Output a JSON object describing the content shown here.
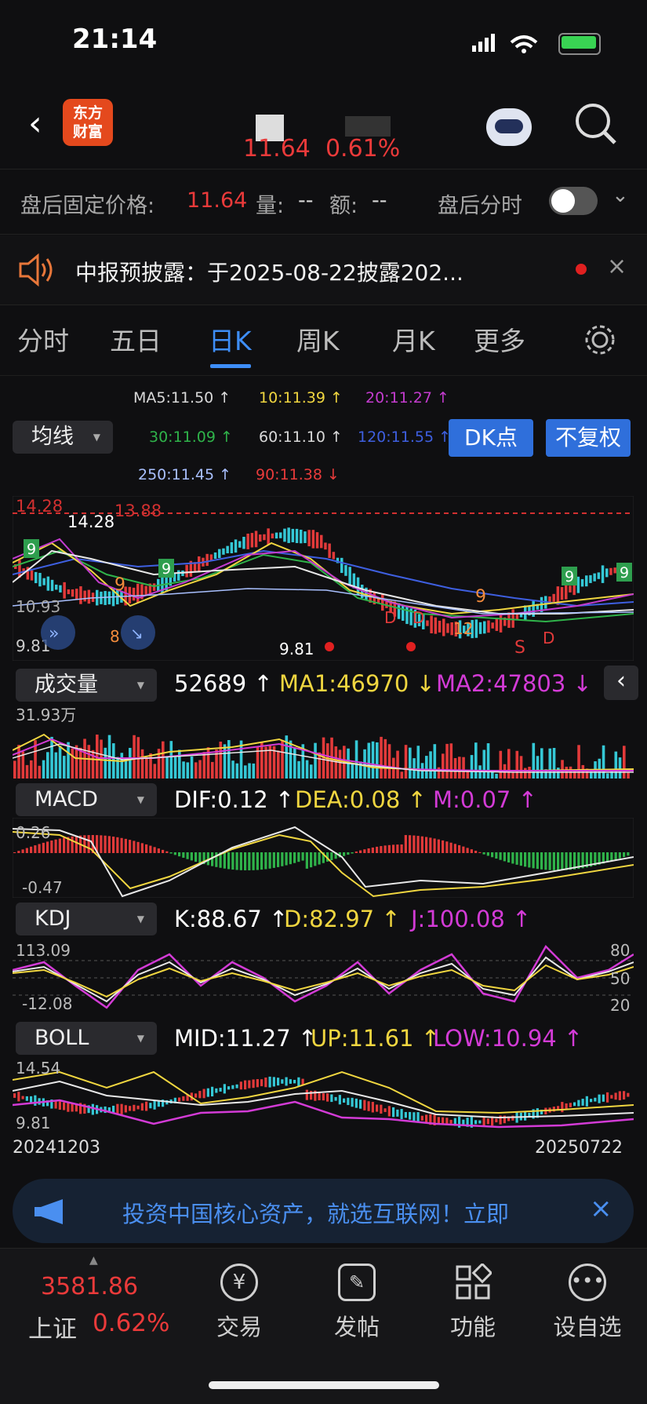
{
  "status": {
    "time": "21:14"
  },
  "header": {
    "logo_text_1": "东方",
    "logo_text_2": "财富",
    "price": "11.64",
    "change_pct": "0.61%"
  },
  "postbar": {
    "label": "盘后固定价格:",
    "price": "11.64",
    "vol_label": "量:",
    "vol_value": "--",
    "amt_label": "额:",
    "amt_value": "--",
    "fenshi_label": "盘后分时"
  },
  "notice": {
    "text": "中报预披露：于2025-08-22披露202..."
  },
  "tabs": [
    "分时",
    "五日",
    "日K",
    "周K",
    "月K",
    "更多"
  ],
  "ma_panel": {
    "dropdown": "均线",
    "ma": [
      {
        "text": "MA5:11.50 ↑",
        "color": "#e8e8e8"
      },
      {
        "text": "10:11.39 ↑",
        "color": "#f0d640"
      },
      {
        "text": "20:11.27 ↑",
        "color": "#c43ccf"
      },
      {
        "text": "30:11.09 ↑",
        "color": "#2fb34a"
      },
      {
        "text": "60:11.10 ↑",
        "color": "#dddddd"
      },
      {
        "text": "120:11.55 ↑",
        "color": "#3e5fe0"
      },
      {
        "text": "250:11.45 ↑",
        "color": "#a9c0ff"
      },
      {
        "text": "90:11.38 ↓",
        "color": "#e83b3b"
      }
    ],
    "dk_button": "DK点",
    "fq_button": "不复权"
  },
  "kline": {
    "price_label_top": "14.28",
    "dash_label": "13.88",
    "mid_label": "10.93",
    "low_left": "9.81",
    "low_mark": "9.81",
    "label_8": "8",
    "label_12": "12"
  },
  "volume": {
    "dropdown": "成交量",
    "value": "52689 ↑",
    "ma1": "MA1:46970 ↓",
    "ma2": "MA2:47803 ↓",
    "axis_top": "31.93万"
  },
  "macd": {
    "dropdown": "MACD",
    "dif": "DIF:0.12 ↑",
    "dea": "DEA:0.08 ↑",
    "m": "M:0.07 ↑",
    "top": "0.26",
    "bottom": "-0.47"
  },
  "kdj": {
    "dropdown": "KDJ",
    "k": "K:88.67 ↑",
    "d": "D:82.97 ↑",
    "j": "J:100.08 ↑",
    "top": "113.09",
    "bottom": "-12.08",
    "r80": "80",
    "r50": "50",
    "r20": "20"
  },
  "boll": {
    "dropdown": "BOLL",
    "mid": "MID:11.27 ↑",
    "up": "UP:11.61 ↑",
    "low": "LOW:10.94 ↑",
    "top": "14.54",
    "bottom": "9.81"
  },
  "dates": {
    "start": "20241203",
    "end": "20250722"
  },
  "ad": {
    "text": "投资中国核心资产，就选互联网！立即"
  },
  "bottom": {
    "index_value": "3581.86",
    "index_name": "上证",
    "index_pct": "0.62%",
    "nav": [
      "交易",
      "发帖",
      "功能",
      "设自选"
    ]
  }
}
